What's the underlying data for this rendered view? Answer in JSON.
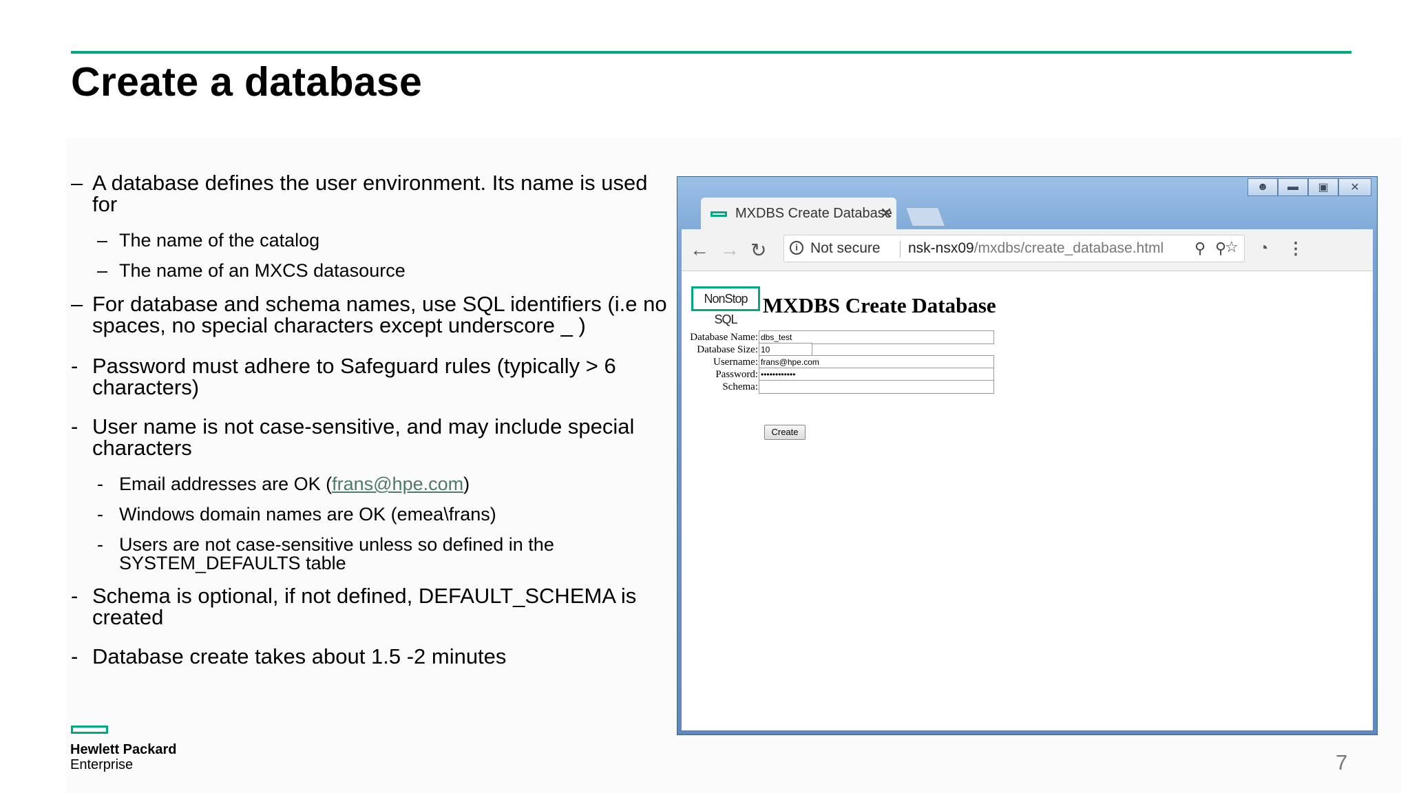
{
  "slide": {
    "title": "Create a database",
    "page_number": "7",
    "logo_line1": "Hewlett Packard",
    "logo_line2": "Enterprise",
    "accent": "#01a982"
  },
  "bullets": [
    {
      "level": 1,
      "marker": "–",
      "text": "A database defines the user environment. Its name is used for"
    },
    {
      "level": 2,
      "marker": "–",
      "text": "The name of the catalog"
    },
    {
      "level": 2,
      "marker": "–",
      "text": "The name of an MXCS datasource"
    },
    {
      "level": 1,
      "marker": "–",
      "text": "For database and schema names, use SQL identifiers (i.e no spaces, no special characters except underscore _ )"
    },
    {
      "level": 1,
      "marker": "-",
      "text": "Password must adhere to Safeguard rules (typically > 6 characters)"
    },
    {
      "level": 1,
      "marker": "-",
      "text": "User name is not case-sensitive, and may include special characters"
    },
    {
      "level": 2,
      "marker": "-",
      "text_before": "Email addresses are OK (",
      "link": "frans@hpe.com",
      "text_after": ")"
    },
    {
      "level": 2,
      "marker": "-",
      "text": "Windows domain names are OK (emea\\frans)"
    },
    {
      "level": 2,
      "marker": "-",
      "text": "Users are not case-sensitive unless so defined in the SYSTEM_DEFAULTS table"
    },
    {
      "level": 1,
      "marker": "-",
      "text": "Schema is optional, if not defined, DEFAULT_SCHEMA is created"
    },
    {
      "level": 1,
      "marker": "-",
      "text": "Database create takes about 1.5 -2 minutes"
    }
  ],
  "browser": {
    "tab_title": "MXDBS Create Database",
    "not_secure": "Not secure",
    "url_host": "nsk-nsx09",
    "url_path": "/mxdbs/create_database.html",
    "icons": [
      "back-arrow-icon",
      "forward-arrow-icon",
      "reload-icon",
      "info-icon",
      "zoom-icon",
      "key-icon",
      "star-icon",
      "speed-icon",
      "menu-dots-icon"
    ]
  },
  "form": {
    "logo_text": "NonStop SQL",
    "heading": "MXDBS Create Database",
    "fields": [
      {
        "label": "Database Name:",
        "value": "dbs_test"
      },
      {
        "label": "Database Size:",
        "value": "10"
      },
      {
        "label": "Username:",
        "value": "frans@hpe.com"
      },
      {
        "label": "Password:",
        "value": "••••••••••••"
      },
      {
        "label": "Schema:",
        "value": ""
      }
    ],
    "submit_label": "Create"
  }
}
